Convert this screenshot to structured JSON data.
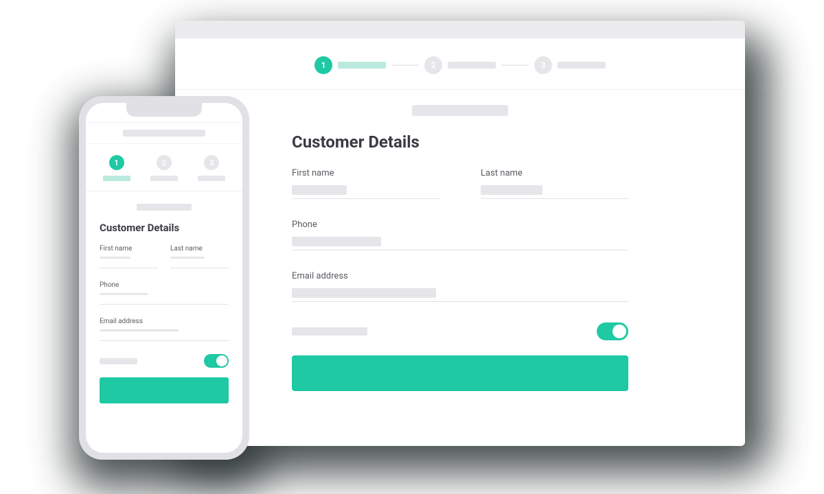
{
  "colors": {
    "accent": "#1ec9a3",
    "placeholder": "#e6e6ea"
  },
  "stepper": {
    "steps": [
      {
        "num": "1",
        "active": true
      },
      {
        "num": "2",
        "active": false
      },
      {
        "num": "3",
        "active": false
      }
    ]
  },
  "form": {
    "heading": "Customer Details",
    "fields": {
      "first_name": {
        "label": "First name"
      },
      "last_name": {
        "label": "Last name"
      },
      "phone": {
        "label": "Phone"
      },
      "email": {
        "label": "Email address"
      }
    },
    "toggle_on": true
  }
}
